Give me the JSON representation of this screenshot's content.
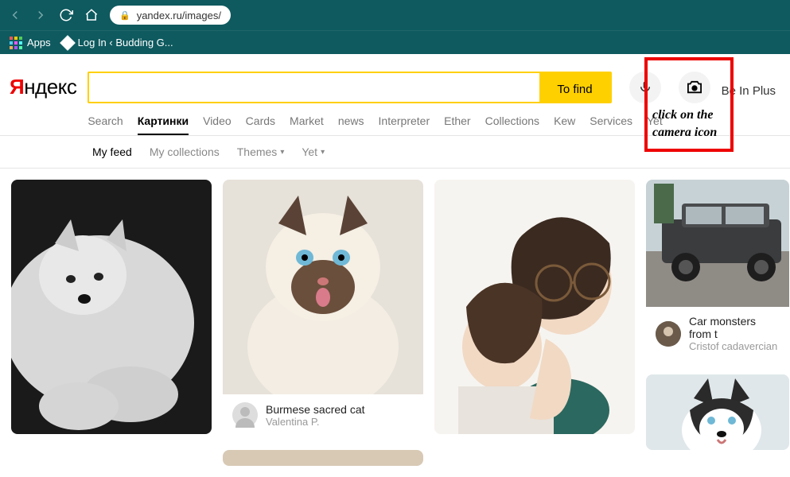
{
  "browser": {
    "url": "yandex.ru/images/",
    "bookmarks": {
      "apps": "Apps",
      "login": "Log In ‹ Budding G..."
    }
  },
  "logo_red": "Я",
  "logo_rest": "ндекс",
  "search": {
    "find": "To find",
    "placeholder": ""
  },
  "be_plus": "Be In Plus",
  "tabs": [
    "Search",
    "Картинки",
    "Video",
    "Cards",
    "Market",
    "news",
    "Interpreter",
    "Ether",
    "Collections",
    "Kew",
    "Services",
    "Yet"
  ],
  "active_tab_index": 1,
  "subnav": {
    "items": [
      "My feed",
      "My collections",
      "Themes",
      "Yet"
    ],
    "active_index": 0,
    "dropdown_indexes": [
      2,
      3
    ]
  },
  "annotation": "click on the camera icon",
  "cards": {
    "cat": {
      "title": "Burmese sacred cat",
      "author": "Valentina P."
    },
    "car": {
      "title": "Car monsters from t",
      "author": "Cristof cadavercian"
    }
  }
}
